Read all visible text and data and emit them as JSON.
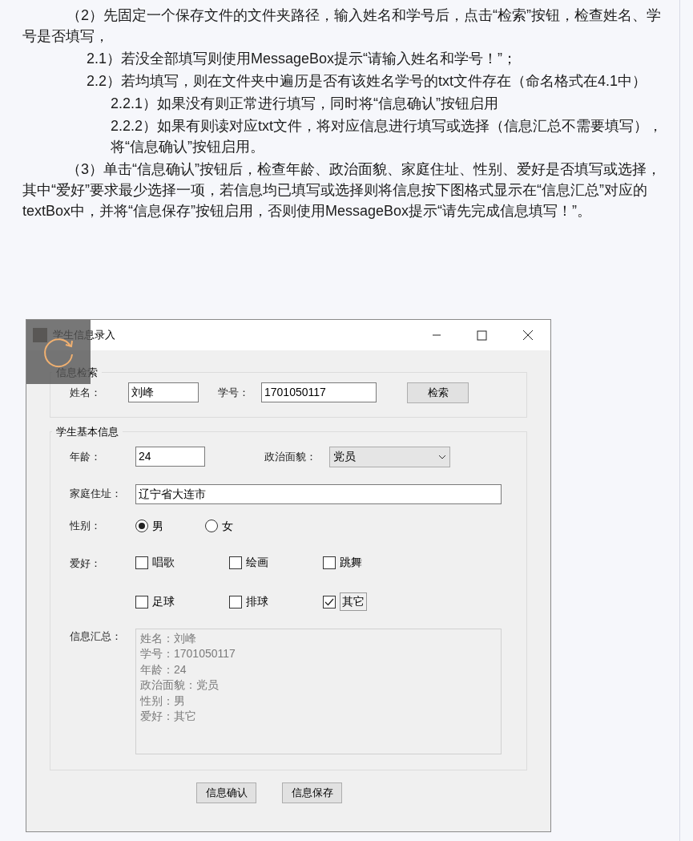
{
  "document": {
    "paragraphs": [
      {
        "kind": "body",
        "text": "（2）先固定一个保存文件的文件夹路径，输入姓名和学号后，点击“检索”按钮，检查姓名、学号是否填写，"
      },
      {
        "kind": "sub",
        "text": "2.1）若没全部填写则使用MessageBox提示“请输入姓名和学号！”；"
      },
      {
        "kind": "sub",
        "text": "2.2）若均填写，则在文件夹中遍历是否有该姓名学号的txt文件存在（命名格式在4.1中）"
      },
      {
        "kind": "subsub",
        "text": "2.2.1）如果没有则正常进行填写，同时将“信息确认”按钮启用"
      },
      {
        "kind": "subsub",
        "text": "2.2.2）如果有则读对应txt文件，将对应信息进行填写或选择（信息汇总不需要填写），将“信息确认”按钮启用。"
      },
      {
        "kind": "body",
        "text": "（3）单击“信息确认”按钮后，检查年龄、政治面貌、家庭住址、性别、爱好是否填写或选择，其中“爱好”要求最少选择一项，若信息均已填写或选择则将信息按下图格式显示在“信息汇总”对应的textBox中，并将“信息保存”按钮启用，否则使用MessageBox提示“请先完成信息填写！”。"
      }
    ]
  },
  "window": {
    "title": "学生信息录入"
  },
  "search_group": {
    "title": "信息检索",
    "name_label": "姓名：",
    "name_value": "刘峰",
    "id_label": "学号：",
    "id_value": "1701050117",
    "button": "检索"
  },
  "basic_group": {
    "title": "学生基本信息",
    "age_label": "年龄：",
    "age_value": "24",
    "politics_label": "政治面貌：",
    "politics_value": "党员",
    "address_label": "家庭住址：",
    "address_value": "辽宁省大连市",
    "gender_label": "性别：",
    "genders": [
      {
        "label": "男",
        "selected": true
      },
      {
        "label": "女",
        "selected": false
      }
    ],
    "hobby_label": "爱好：",
    "hobbies": [
      {
        "label": "唱歌",
        "checked": false
      },
      {
        "label": "绘画",
        "checked": false
      },
      {
        "label": "跳舞",
        "checked": false
      },
      {
        "label": "足球",
        "checked": false
      },
      {
        "label": "排球",
        "checked": false
      },
      {
        "label": "其它",
        "checked": true
      }
    ],
    "summary_label": "信息汇总：",
    "summary_lines": [
      "姓名：刘峰",
      "学号：1701050117",
      "年龄：24",
      "政治面貌：党员",
      "性别：男",
      "爱好：其它"
    ]
  },
  "buttons": [
    "信息确认",
    "信息保存"
  ]
}
